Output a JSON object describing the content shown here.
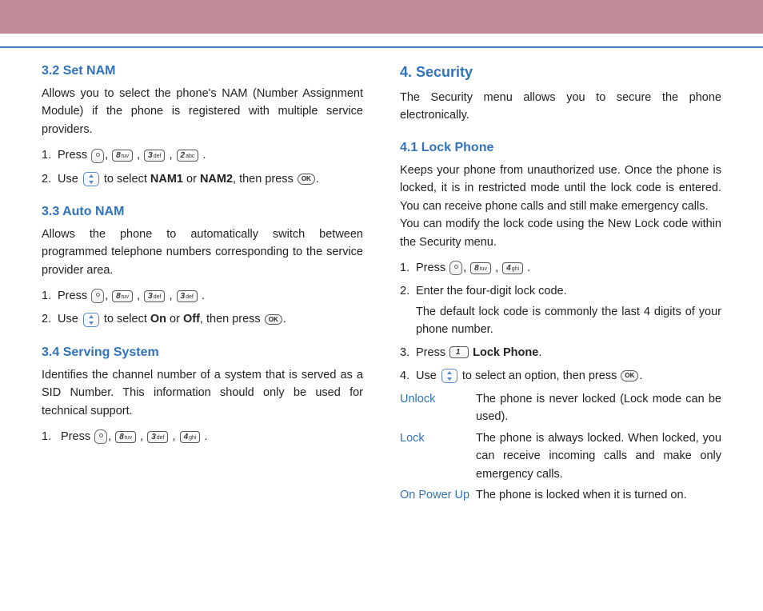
{
  "left": {
    "s32": {
      "title": "3.2 Set NAM",
      "para": "Allows you to select the phone's NAM (Number Assignment Module) if the phone is registered with multiple service providers.",
      "step1_a": "Press ",
      "step1_b": ".",
      "step2_a": "Use ",
      "step2_b": " to select ",
      "step2_c": " or ",
      "step2_d": ", then press ",
      "step2_e": ".",
      "nam1": "NAM1",
      "nam2": "NAM2"
    },
    "s33": {
      "title": "3.3 Auto NAM",
      "para": "Allows the phone to automatically switch between programmed telephone numbers corresponding to the service provider area.",
      "step1_a": "Press ",
      "step1_b": ".",
      "step2_a": "Use ",
      "step2_b": " to select ",
      "step2_c": " or ",
      "step2_d": ", then press ",
      "step2_e": ".",
      "on": "On",
      "off": "Off"
    },
    "s34": {
      "title": "3.4 Serving System",
      "para": "Identifies the channel number of a system that is served as a SID Number. This information should only be used for technical support.",
      "step1_a": "Press ",
      "step1_b": "."
    }
  },
  "right": {
    "s4": {
      "title": "4. Security",
      "para": "The Security menu allows you to secure the phone electronically."
    },
    "s41": {
      "title": "4.1 Lock Phone",
      "para1": "Keeps your phone from unauthorized use. Once the phone is locked, it is in restricted mode until the lock code is entered. You can receive phone calls and still make emergency calls.",
      "para2": "You can modify the lock code using the New Lock code within the Security menu.",
      "step1_a": "Press ",
      "step1_b": ".",
      "step2_a": "Enter the four-digit lock code.",
      "step2_b": "The default lock code is commonly the last 4 digits of your phone number.",
      "step3_a": "Press ",
      "step3_b": " ",
      "step3_c": ".",
      "lockphone": "Lock Phone",
      "step4_a": "Use ",
      "step4_b": " to select an option, then press ",
      "step4_c": ".",
      "opts": {
        "unlock": {
          "label": "Unlock",
          "desc": "The phone is never locked (Lock mode can be used)."
        },
        "lock": {
          "label": "Lock",
          "desc": "The phone is always locked. When locked, you can receive incoming calls and make only emergency calls."
        },
        "power": {
          "label": "On Power Up",
          "desc": "The phone is locked when it is turned on."
        }
      }
    }
  },
  "keys": {
    "k1": {
      "digit": "1",
      "letters": ""
    },
    "k2": {
      "digit": "2",
      "letters": "abc"
    },
    "k3": {
      "digit": "3",
      "letters": "def"
    },
    "k4": {
      "digit": "4",
      "letters": "ghi"
    },
    "k8": {
      "digit": "8",
      "letters": "tuv"
    },
    "ok": "OK"
  }
}
